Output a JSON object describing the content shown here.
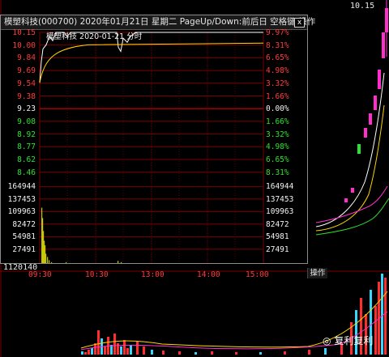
{
  "window": {
    "title": "模塑科技(000700)  2020年01月21日  星期二  PageUp/Down:前后日  空格键:操作",
    "close_label": "x",
    "subtitle": "模塑科技   2020-01-21 分时"
  },
  "price_labels_left": [
    "10.15",
    "10.00",
    "9.84",
    "9.69",
    "9.54",
    "9.38",
    "9.23",
    "9.08",
    "8.92",
    "8.77",
    "8.62",
    "8.46"
  ],
  "price_labels_right": [
    "9.97%",
    "8.31%",
    "6.65%",
    "4.98%",
    "3.32%",
    "1.66%",
    "0.00%",
    "1.66%",
    "3.32%",
    "4.98%",
    "6.65%",
    "8.31%"
  ],
  "volume_labels_left": [
    "164944",
    "137453",
    "109963",
    "82472",
    "54981",
    "27491"
  ],
  "volume_labels_right": [
    "164944",
    "137453",
    "109963",
    "82472",
    "54981",
    "27491"
  ],
  "time_labels": [
    "09:30",
    "10:30",
    "13:00",
    "14:00",
    "15:00"
  ],
  "operate_label": "操作",
  "bottom_volume_value": "1120140",
  "current_price": "10.15",
  "watermark": "复利复利",
  "colors": {
    "up": "#ff3b3b",
    "down": "#2ee12e",
    "grid": "#7a0000",
    "price_line": "#ffffff",
    "avg_line": "#ffd700",
    "volume": "#c8c800"
  }
}
